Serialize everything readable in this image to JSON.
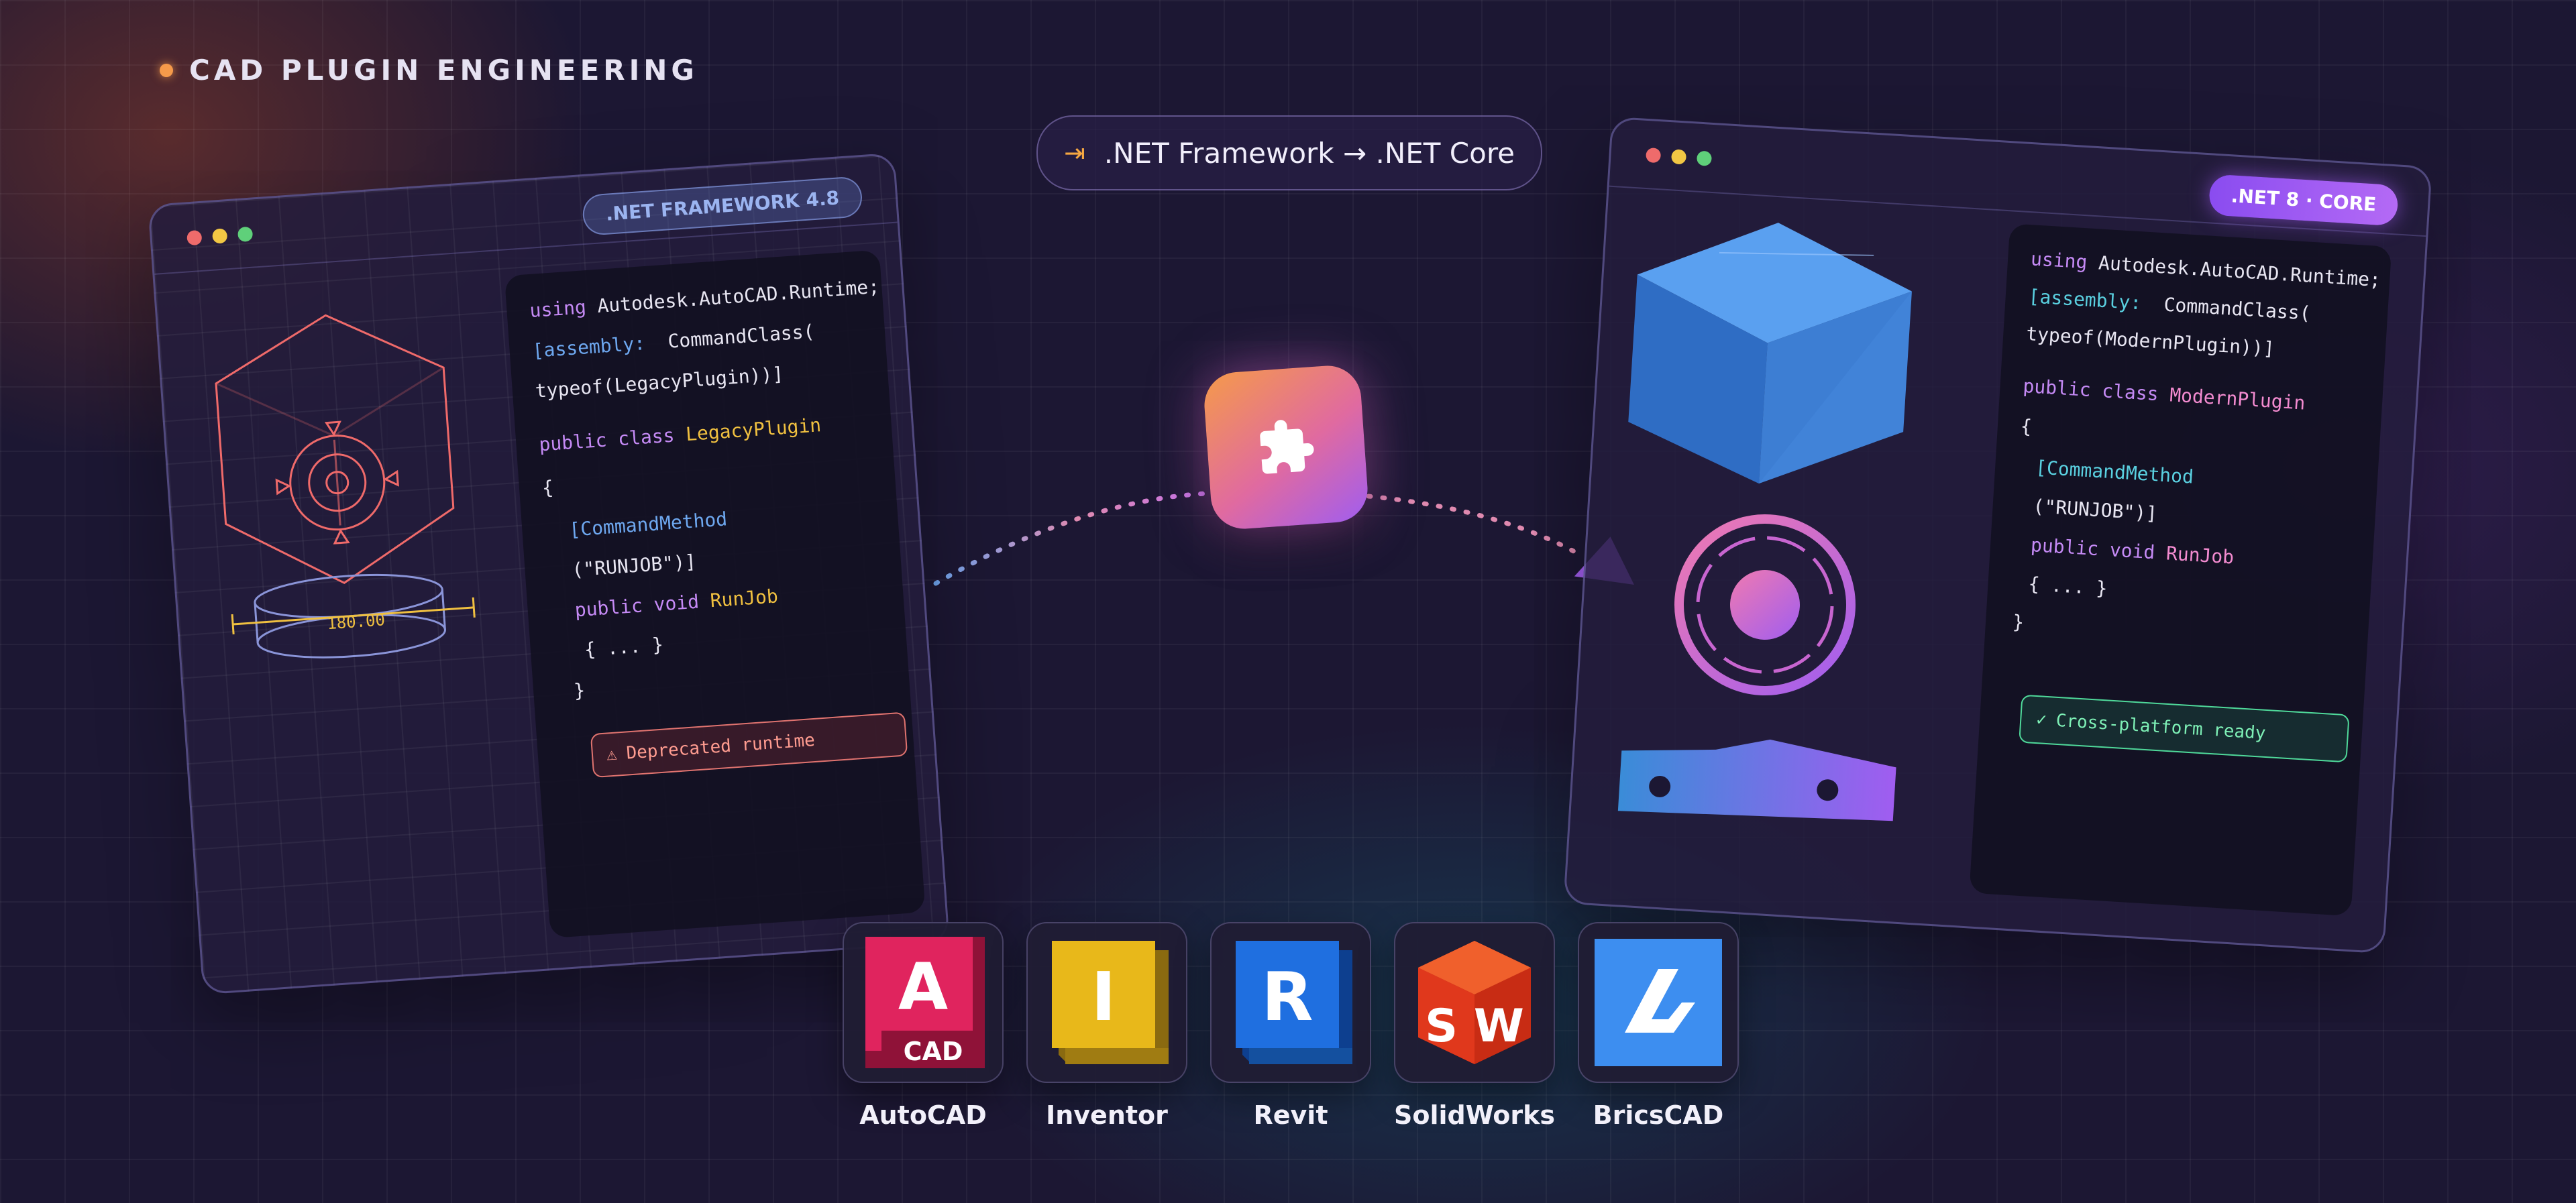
{
  "header": {
    "eyebrow": "CAD PLUGIN ENGINEERING"
  },
  "migration": {
    "icon": "arrow-into-bar-icon",
    "label": ".NET Framework → .NET Core"
  },
  "legacy_window": {
    "badge": ".NET FRAMEWORK 4.8",
    "dimension_label": "180.00",
    "code": {
      "l1_kw": "using",
      "l1_rest": " Autodesk.AutoCAD.Runtime;",
      "l2_at": "[assembly:",
      "l2_rest": "  CommandClass(",
      "l3": "typeof(LegacyPlugin))]",
      "l4_kw": "public class ",
      "l4_cls": "LegacyPlugin",
      "l5": "{",
      "l6_at": "[CommandMethod",
      "l7": "(\"RUNJOB\")]",
      "l8_kw": "public void ",
      "l8_cls": "RunJob",
      "l9": "{ ... }",
      "l10": "}"
    },
    "status_icon": "warning-icon",
    "status": "Deprecated runtime"
  },
  "modern_window": {
    "badge": ".NET 8 · CORE",
    "code": {
      "l1_kw": "using",
      "l1_rest": " Autodesk.AutoCAD.Runtime;",
      "l2_at": "[assembly:",
      "l2_rest": "  CommandClass(",
      "l3": "typeof(ModernPlugin))]",
      "l4_kw": "public class ",
      "l4_cls": "ModernPlugin",
      "l5": "{",
      "l6_at": "[CommandMethod",
      "l7": "(\"RUNJOB\")]",
      "l8_kw": "public void ",
      "l8_cls": "RunJob",
      "l9": "{ ... }",
      "l10": "}"
    },
    "status_icon": "check-icon",
    "status": "Cross-platform ready"
  },
  "plugin_tile": {
    "icon": "puzzle-piece-icon"
  },
  "apps": [
    {
      "name": "AutoCAD",
      "icon": "autocad-logo",
      "glyph": "A",
      "sub": "CAD",
      "color": "#e0245e"
    },
    {
      "name": "Inventor",
      "icon": "inventor-logo",
      "glyph": "I",
      "color": "#e8b81a"
    },
    {
      "name": "Revit",
      "icon": "revit-logo",
      "glyph": "R",
      "color": "#1f6fe0"
    },
    {
      "name": "SolidWorks",
      "icon": "solidworks-logo",
      "glyph": "S W",
      "color": "#e0381c"
    },
    {
      "name": "BricsCAD",
      "icon": "bricscad-logo",
      "color": "#3d8ef0"
    }
  ],
  "colors": {
    "background": "#1c1733",
    "accent_orange": "#f59a4a",
    "accent_purple": "#a05df0",
    "legacy_stroke": "#ef6a6a",
    "modern_blue": "#4a7ee0"
  }
}
